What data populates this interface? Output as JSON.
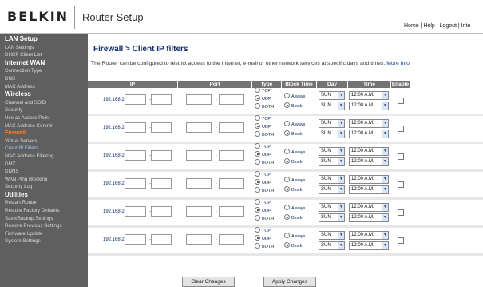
{
  "header": {
    "logo": "BELKIN",
    "title": "Router Setup",
    "links": [
      "Home",
      "Help",
      "Logout",
      "Inte"
    ]
  },
  "sidebar": {
    "items": [
      {
        "label": "LAN Setup",
        "kind": "section"
      },
      {
        "label": "LAN Settings",
        "kind": "item"
      },
      {
        "label": "DHCP Client List",
        "kind": "item"
      },
      {
        "label": "Internet WAN",
        "kind": "section"
      },
      {
        "label": "Connection Type",
        "kind": "item"
      },
      {
        "label": "DNS",
        "kind": "item"
      },
      {
        "label": "MAC Address",
        "kind": "item"
      },
      {
        "label": "Wireless",
        "kind": "section"
      },
      {
        "label": "Channel and SSID",
        "kind": "item"
      },
      {
        "label": "Security",
        "kind": "item"
      },
      {
        "label": "Use as Access Point",
        "kind": "item"
      },
      {
        "label": "MAC Address Control",
        "kind": "item"
      },
      {
        "label": "Firewall",
        "kind": "active"
      },
      {
        "label": "Virtual Servers",
        "kind": "item"
      },
      {
        "label": "Client IP Filters",
        "kind": "current"
      },
      {
        "label": "MAC Address Filtering",
        "kind": "item"
      },
      {
        "label": "DMZ",
        "kind": "item"
      },
      {
        "label": "DDNS",
        "kind": "item"
      },
      {
        "label": "WAN Ping Blocking",
        "kind": "item"
      },
      {
        "label": "Security Log",
        "kind": "item"
      },
      {
        "label": "Utilities",
        "kind": "section"
      },
      {
        "label": "Restart Router",
        "kind": "item"
      },
      {
        "label": "Restore Factory Defaults",
        "kind": "item"
      },
      {
        "label": "Save/Backup Settings",
        "kind": "item"
      },
      {
        "label": "Restore Previous Settings",
        "kind": "item"
      },
      {
        "label": "Firmware Update",
        "kind": "item"
      },
      {
        "label": "System Settings",
        "kind": "item"
      }
    ]
  },
  "main": {
    "title": "Firewall > Client IP filters",
    "description": "The Router can be configured to restrict access to the Internet, e-mail or other network services at specific days and times.",
    "more_info": "More Info"
  },
  "table": {
    "headers": [
      "IP",
      "Port",
      "Type",
      "Block Time",
      "Day",
      "Time",
      "Enable"
    ],
    "ip_prefix": "192.168.2.",
    "type_options": [
      "TCP",
      "UDP",
      "BOTH"
    ],
    "block_options": [
      "Always",
      "Block"
    ],
    "rows": [
      {
        "type": "UDP",
        "block": "Block",
        "day_from": "SUN",
        "day_to": "SUN",
        "time_from": "12:00 A.M.",
        "time_to": "12:00 A.M.",
        "enabled": false
      },
      {
        "type": "UDP",
        "block": "Block",
        "day_from": "SUN",
        "day_to": "SUN",
        "time_from": "12:00 A.M.",
        "time_to": "12:00 A.M.",
        "enabled": false
      },
      {
        "type": "UDP",
        "block": "Block",
        "day_from": "SUN",
        "day_to": "SUN",
        "time_from": "12:00 A.M.",
        "time_to": "12:00 A.M.",
        "enabled": false
      },
      {
        "type": "UDP",
        "block": "Block",
        "day_from": "SUN",
        "day_to": "SUN",
        "time_from": "12:00 A.M.",
        "time_to": "12:00 A.M.",
        "enabled": false
      },
      {
        "type": "UDP",
        "block": "Block",
        "day_from": "SUN",
        "day_to": "SUN",
        "time_from": "12:00 A.M.",
        "time_to": "12:00 A.M.",
        "enabled": false
      },
      {
        "type": "UDP",
        "block": "Block",
        "day_from": "SUN",
        "day_to": "SUN",
        "time_from": "12:00 A.M.",
        "time_to": "12:00 A.M.",
        "enabled": false
      }
    ]
  },
  "buttons": {
    "clear": "Clear Changes",
    "apply": "Apply Changes"
  },
  "colors": {
    "sidebar_bg": "#5f5f5f",
    "active_section": "#ff7a2a",
    "title_blue": "#0e2c66",
    "table_header": "#737373"
  }
}
